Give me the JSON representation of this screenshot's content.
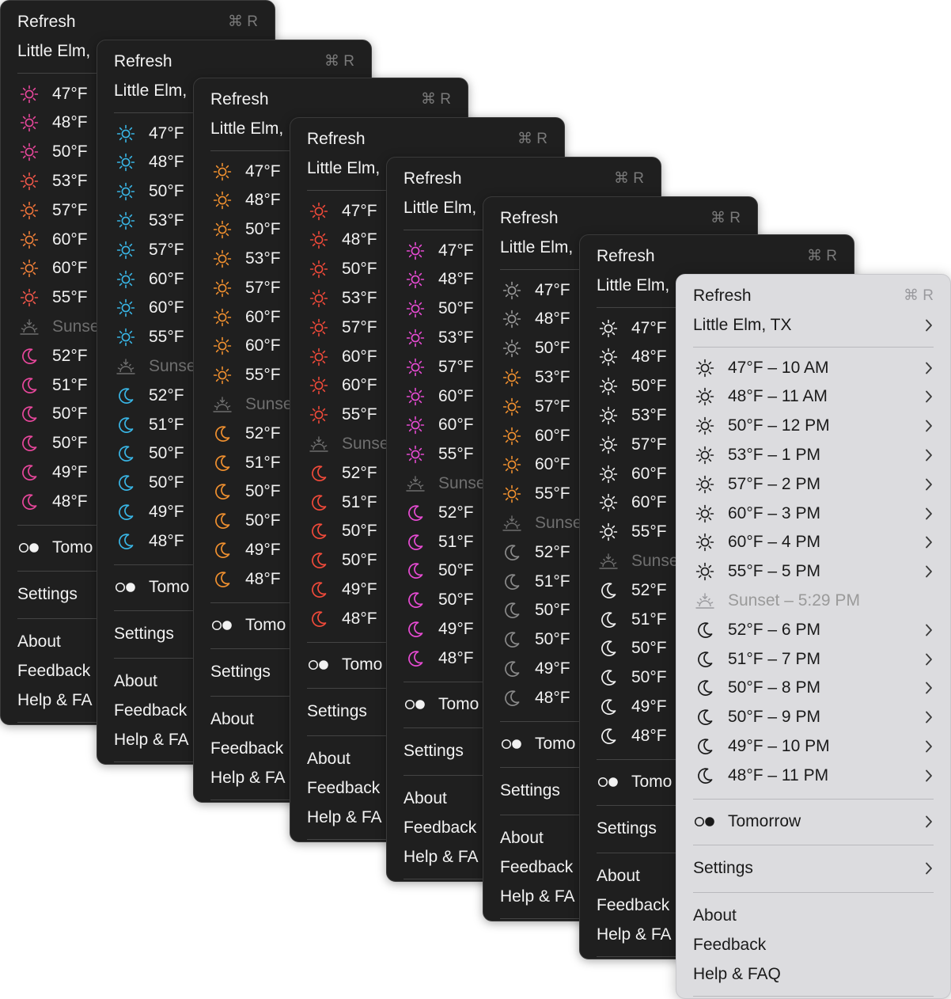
{
  "menu": {
    "refresh_label": "Refresh",
    "refresh_shortcut": "⌘ R",
    "location": "Little Elm, TX",
    "location_short": "Little Elm,",
    "hours": [
      {
        "temp": "47°F",
        "time": "10 AM",
        "label": "47°F – 10 AM",
        "kind": "sun"
      },
      {
        "temp": "48°F",
        "time": "11 AM",
        "label": "48°F – 11 AM",
        "kind": "sun"
      },
      {
        "temp": "50°F",
        "time": "12 PM",
        "label": "50°F – 12 PM",
        "kind": "sun"
      },
      {
        "temp": "53°F",
        "time": "1 PM",
        "label": "53°F – 1 PM",
        "kind": "sun"
      },
      {
        "temp": "57°F",
        "time": "2 PM",
        "label": "57°F – 2 PM",
        "kind": "sun"
      },
      {
        "temp": "60°F",
        "time": "3 PM",
        "label": "60°F – 3 PM",
        "kind": "sun"
      },
      {
        "temp": "60°F",
        "time": "4 PM",
        "label": "60°F – 4 PM",
        "kind": "sun"
      },
      {
        "temp": "55°F",
        "time": "5 PM",
        "label": "55°F – 5 PM",
        "kind": "sun"
      },
      {
        "temp": "Sunset",
        "time": "5:29 PM",
        "label": "Sunset – 5:29 PM",
        "kind": "sunset"
      },
      {
        "temp": "52°F",
        "time": "6 PM",
        "label": "52°F – 6 PM",
        "kind": "moon"
      },
      {
        "temp": "51°F",
        "time": "7 PM",
        "label": "51°F – 7 PM",
        "kind": "moon"
      },
      {
        "temp": "50°F",
        "time": "8 PM",
        "label": "50°F – 8 PM",
        "kind": "moon"
      },
      {
        "temp": "50°F",
        "time": "9 PM",
        "label": "50°F – 9 PM",
        "kind": "moon"
      },
      {
        "temp": "49°F",
        "time": "10 PM",
        "label": "49°F – 10 PM",
        "kind": "moon"
      },
      {
        "temp": "48°F",
        "time": "11 PM",
        "label": "48°F – 11 PM",
        "kind": "moon"
      }
    ],
    "sunset_short": "Sunset",
    "tomorrow_label": "Tomorrow",
    "tomorrow_short": "Tomo",
    "settings_label": "Settings",
    "about_label": "About",
    "feedback_label": "Feedback",
    "help_label": "Help & FAQ",
    "help_short": "Help & FA"
  },
  "themes": [
    {
      "name": "pink-orange",
      "sun_colors": [
        "#e8479c",
        "#e8479c",
        "#e8479c",
        "#f0574a",
        "#f0743a",
        "#f0813a",
        "#f0813a",
        "#f0574a"
      ],
      "moon_color": "#e8479c"
    },
    {
      "name": "cyan",
      "sun_color": "#39b6e6",
      "moon_color": "#39b6e6"
    },
    {
      "name": "orange",
      "sun_color": "#f0902f",
      "moon_color": "#f0902f"
    },
    {
      "name": "red",
      "sun_color": "#f04a3a",
      "moon_color": "#f04a3a"
    },
    {
      "name": "magenta",
      "sun_color": "#e84bd4",
      "moon_color": "#e84bd4"
    },
    {
      "name": "gray-orange",
      "sun_colors": [
        "#9a9a9a",
        "#9a9a9a",
        "#9a9a9a",
        "#f0902f",
        "#f0902f",
        "#f0902f",
        "#f0902f",
        "#f0902f"
      ],
      "moon_color": "#8a8a8a"
    },
    {
      "name": "white",
      "sun_color": "#f2f2f2",
      "moon_color": "#f2f2f2"
    },
    {
      "name": "light",
      "sun_color": "#1a1a1a",
      "moon_color": "#1a1a1a"
    }
  ],
  "colors": {
    "dark_bg": "#1f1f1f",
    "light_bg": "#dcdcdf",
    "dim_text": "#6f6f6f"
  }
}
